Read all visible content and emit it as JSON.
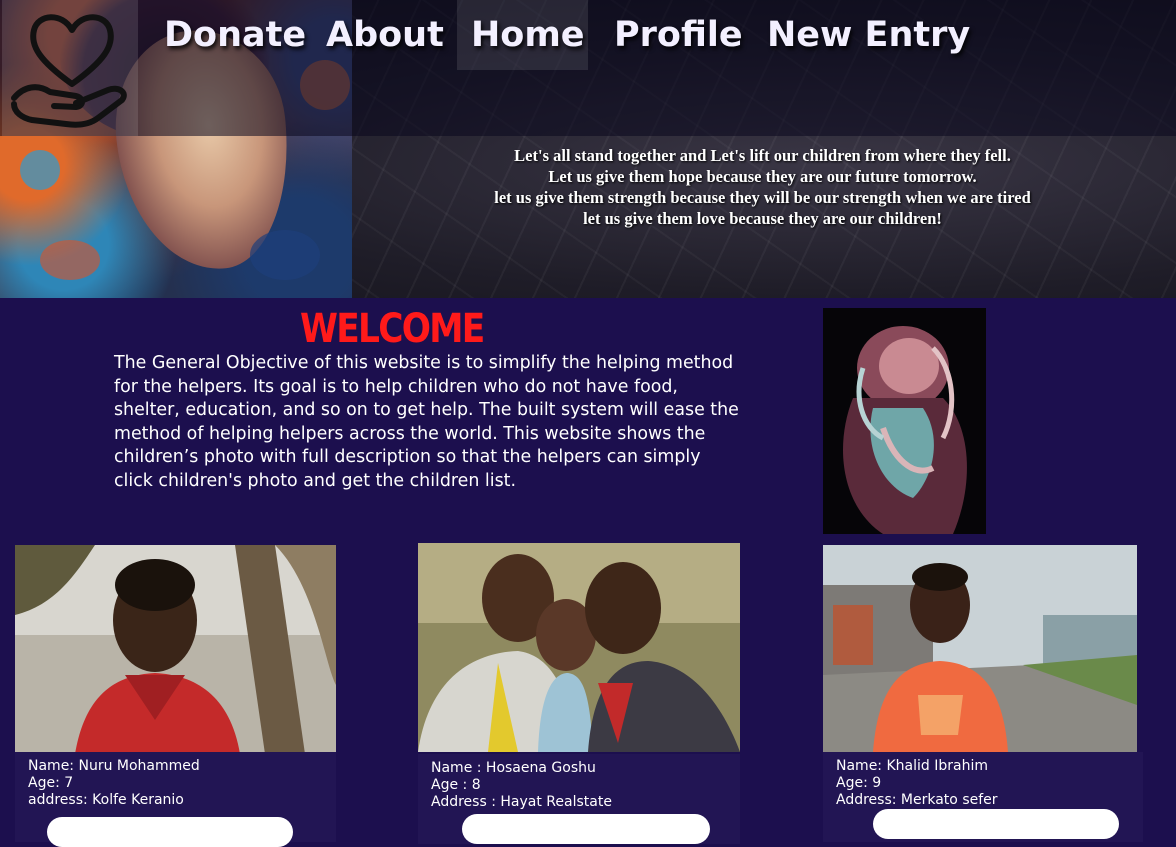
{
  "nav": {
    "logo_icon": "heart-in-hand-icon",
    "items": [
      {
        "label": "Donate"
      },
      {
        "label": "About"
      },
      {
        "label": "Home",
        "active": true
      },
      {
        "label": "Profile"
      },
      {
        "label": "New Entry"
      }
    ]
  },
  "banner": {
    "quote_lines": [
      "Let's all stand together and Let's lift our children from where they fell.",
      "Let us give them hope because they are our future tomorrow.",
      "let us give them strength because they will be our strength when we are tired",
      "let us give them love because they are our children!"
    ]
  },
  "welcome": {
    "title": "Welcome",
    "text": "The General Objective of this website is to simplify the helping method for the helpers. Its goal is to help children who do not have food, shelter, education, and so on to get help. The built system will ease the method of helping helpers across the world. This website shows the children’s photo with full description so that the  helpers can simply click children's photo and get the children list."
  },
  "children": [
    {
      "name": "Name: Nuru Mohammed",
      "age": "Age: 7",
      "address": "address: Kolfe Keranio"
    },
    {
      "name": "Name : Hosaena Goshu",
      "age": "Age : 8",
      "address": "Address : Hayat Realstate"
    },
    {
      "name": "Name: Khalid Ibrahim",
      "age": "Age: 9",
      "address": "Address: Merkato sefer"
    }
  ],
  "colors": {
    "page_background": "#1c0f4e",
    "title_red": "#ff1a1a",
    "card_info_background": "#221554"
  }
}
